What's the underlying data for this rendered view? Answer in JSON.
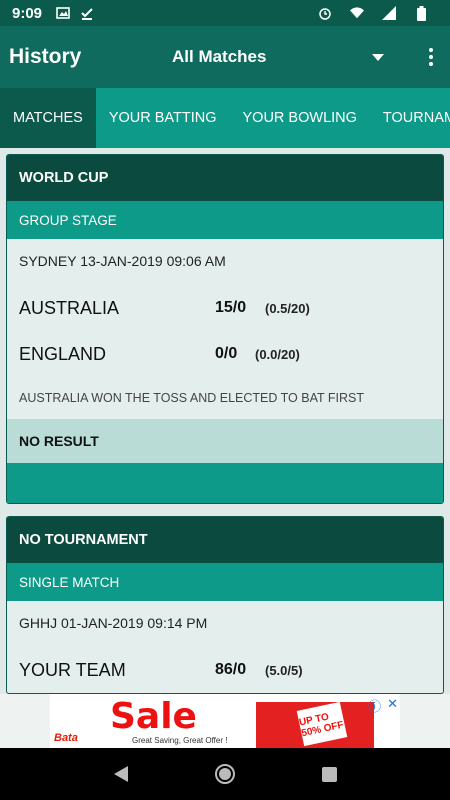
{
  "status_bar": {
    "time": "9:09"
  },
  "app_bar": {
    "title": "History",
    "filter": "All Matches"
  },
  "tabs": [
    "MATCHES",
    "YOUR BATTING",
    "YOUR BOWLING",
    "TOURNAM"
  ],
  "matches": [
    {
      "tournament": "WORLD CUP",
      "stage": "GROUP STAGE",
      "venue_datetime": "SYDNEY 13-JAN-2019 09:06 AM",
      "teams": [
        {
          "name": "AUSTRALIA",
          "score": "15/0",
          "overs": "(0.5/20)"
        },
        {
          "name": "ENGLAND",
          "score": "0/0",
          "overs": "(0.0/20)"
        }
      ],
      "toss": "AUSTRALIA WON THE TOSS AND ELECTED TO BAT FIRST",
      "result": "NO RESULT"
    },
    {
      "tournament": "NO TOURNAMENT",
      "stage": "SINGLE MATCH",
      "venue_datetime": "GHHJ 01-JAN-2019 09:14 PM",
      "teams": [
        {
          "name": "YOUR TEAM",
          "score": "86/0",
          "overs": "(5.0/5)"
        }
      ]
    }
  ],
  "ad": {
    "headline": "Sale",
    "brand": "Bata",
    "tagline": "Great Saving, Great Offer !",
    "tag_text": "UP TO 50% OFF"
  },
  "colors": {
    "primary_dark": "#0b5a4c",
    "primary": "#0e6b5d",
    "accent": "#0e9a88",
    "header_dark": "#0b4a3f",
    "result_bg": "#b9dcd7"
  }
}
